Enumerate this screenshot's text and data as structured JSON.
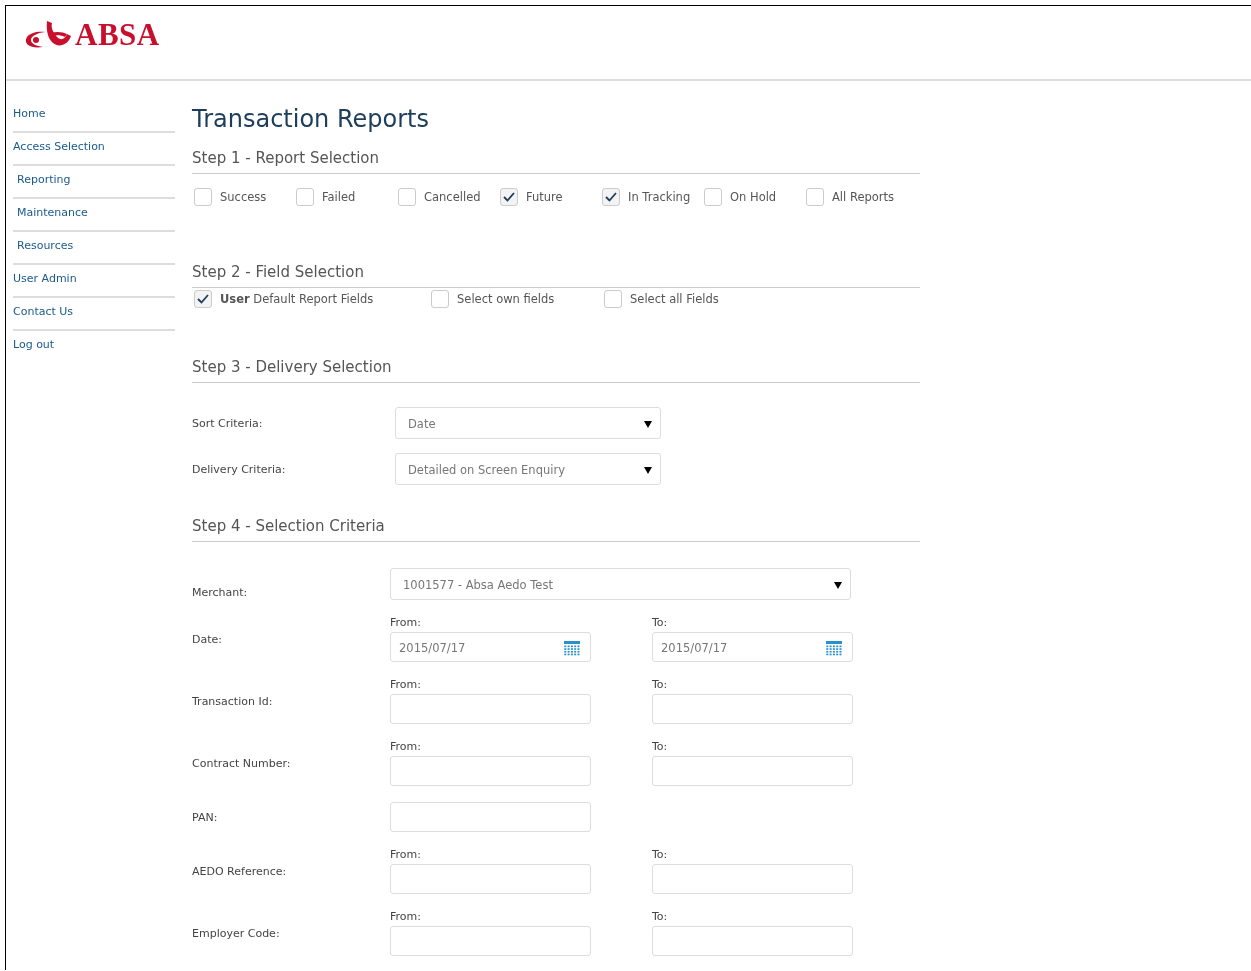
{
  "logo": {
    "text": "ABSA"
  },
  "sidebar": {
    "items": [
      {
        "label": "Home",
        "kind": "top"
      },
      {
        "label": "Access Selection",
        "kind": "top"
      },
      {
        "label": "Reporting",
        "kind": "sub"
      },
      {
        "label": "Maintenance",
        "kind": "sub"
      },
      {
        "label": "Resources",
        "kind": "sub"
      },
      {
        "label": "User Admin",
        "kind": "top"
      },
      {
        "label": "Contact Us",
        "kind": "top"
      },
      {
        "label": "Log out",
        "kind": "top"
      }
    ]
  },
  "title": "Transaction Reports",
  "step1": {
    "heading": "Step 1 - Report Selection",
    "options": [
      {
        "label": "Success",
        "checked": false
      },
      {
        "label": "Failed",
        "checked": false
      },
      {
        "label": "Cancelled",
        "checked": false
      },
      {
        "label": "Future",
        "checked": true
      },
      {
        "label": "In Tracking",
        "checked": true
      },
      {
        "label": "On Hold",
        "checked": false
      },
      {
        "label": "All Reports",
        "checked": false
      }
    ]
  },
  "step2": {
    "heading": "Step 2 - Field Selection",
    "options": [
      {
        "label": "**User** Default Report Fields",
        "checked": true
      },
      {
        "label": "Select own fields",
        "checked": false
      },
      {
        "label": "Select all Fields",
        "checked": false
      }
    ]
  },
  "step3": {
    "heading": "Step 3 - Delivery Selection",
    "fields": [
      {
        "label": "Sort Criteria:",
        "value": "Date"
      },
      {
        "label": "Delivery Criteria:",
        "value": "Detailed on Screen Enquiry"
      }
    ]
  },
  "step4": {
    "heading": "Step 4 - Selection Criteria",
    "rows": [
      {
        "kind": "select",
        "label": "Merchant:",
        "value": "1001577 - Absa Aedo Test"
      },
      {
        "kind": "date",
        "label": "Date:",
        "from_label": "From:",
        "from_value": "2015/07/17",
        "to_label": "To:",
        "to_value": "2015/07/17"
      },
      {
        "kind": "range",
        "label": "Transaction Id:",
        "from_label": "From:",
        "to_label": "To:"
      },
      {
        "kind": "range",
        "label": "Contract Number:",
        "from_label": "From:",
        "to_label": "To:"
      },
      {
        "kind": "single",
        "label": "PAN:"
      },
      {
        "kind": "range",
        "label": "AEDO Reference:",
        "from_label": "From:",
        "to_label": "To:"
      },
      {
        "kind": "range",
        "label": "Employer Code:",
        "from_label": "From:",
        "to_label": "To:"
      }
    ]
  }
}
